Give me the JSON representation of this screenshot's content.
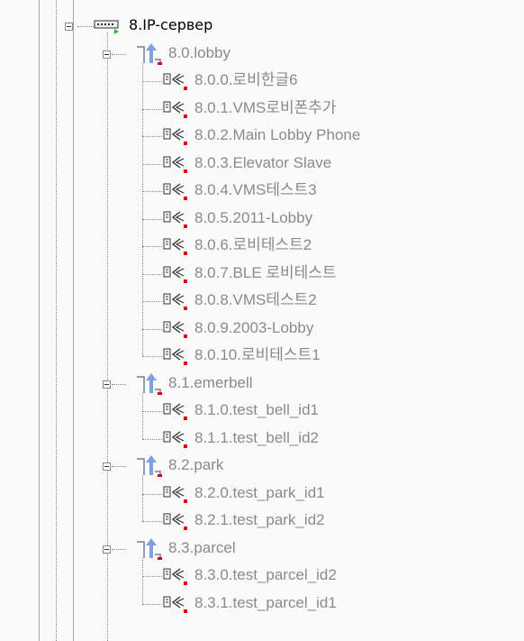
{
  "server": {
    "label": "8.IP-сервер"
  },
  "groups": [
    {
      "label": "8.0.lobby",
      "devices": [
        "8.0.0.로비한글6",
        "8.0.1.VMS로비폰추가",
        "8.0.2.Main Lobby Phone",
        "8.0.3.Elevator Slave",
        "8.0.4.VMS테스트3",
        "8.0.5.2011-Lobby",
        "8.0.6.로비테스트2",
        "8.0.7.BLE 로비테스트",
        "8.0.8.VMS테스트2",
        "8.0.9.2003-Lobby",
        "8.0.10.로비테스트1"
      ]
    },
    {
      "label": "8.1.emerbell",
      "devices": [
        "8.1.0.test_bell_id1",
        "8.1.1.test_bell_id2"
      ]
    },
    {
      "label": "8.2.park",
      "devices": [
        "8.2.0.test_park_id1",
        "8.2.1.test_park_id2"
      ]
    },
    {
      "label": "8.3.parcel",
      "devices": [
        "8.3.0.test_parcel_id2",
        "8.3.1.test_parcel_id1"
      ]
    }
  ],
  "icons": {
    "server": "server-rack-icon",
    "group": "up-arrow-group-icon",
    "device": "intercom-device-icon",
    "toggle": "collapse-minus-icon"
  },
  "colors": {
    "background": "#fafafa",
    "server_text": "#000000",
    "item_text": "#8a8a8a",
    "group_arrow": "#7f9fe0",
    "status_dot": "#e00000",
    "status_triangle": "#2db52d"
  }
}
